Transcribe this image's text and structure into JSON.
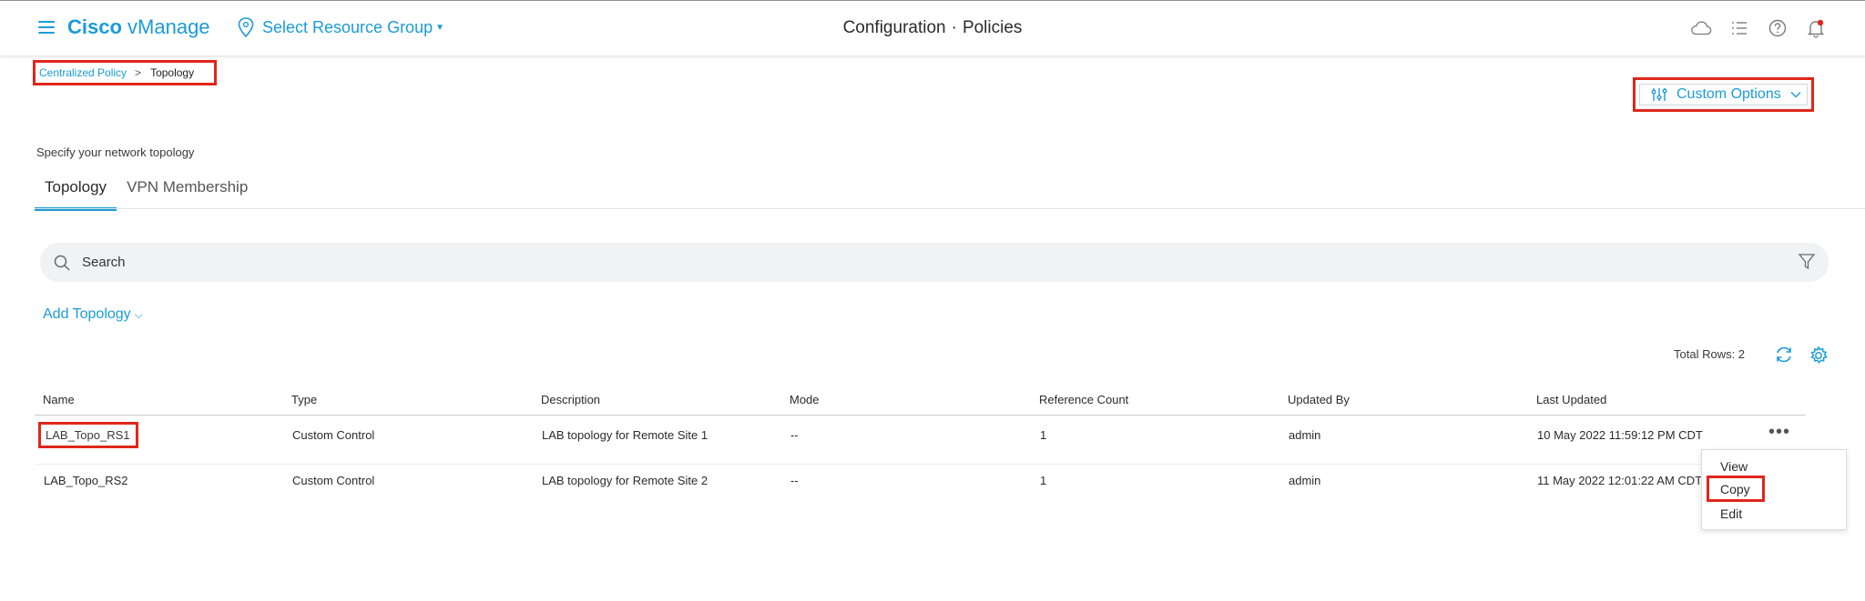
{
  "header": {
    "brand_bold": "Cisco",
    "brand_rest": " vManage",
    "resource_group": "Select Resource Group",
    "title_section": "Configuration",
    "title_dot": "·",
    "title_page": "Policies",
    "icons": [
      "cloud-icon",
      "list-icon",
      "help-icon",
      "bell-icon"
    ],
    "accent_color": "#1b9bd7",
    "notification_color": "#e0261b"
  },
  "breadcrumb": {
    "parent": "Centralized Policy",
    "separator": ">",
    "current": "Topology"
  },
  "custom_options": {
    "label": "Custom Options"
  },
  "page": {
    "subtitle": "Specify your network topology"
  },
  "tabs": [
    {
      "label": "Topology",
      "active": true
    },
    {
      "label": "VPN Membership",
      "active": false
    }
  ],
  "search": {
    "placeholder": "Search"
  },
  "add_topology": {
    "label": "Add Topology"
  },
  "table": {
    "total_rows": "Total Rows: 2",
    "columns": [
      "Name",
      "Type",
      "Description",
      "Mode",
      "Reference Count",
      "Updated By",
      "Last Updated"
    ],
    "rows": [
      {
        "name": "LAB_Topo_RS1",
        "type": "Custom Control",
        "description": "LAB topology for Remote Site 1",
        "mode": "--",
        "reference_count": "1",
        "updated_by": "admin",
        "last_updated": "10 May 2022 11:59:12 PM CDT"
      },
      {
        "name": "LAB_Topo_RS2",
        "type": "Custom Control",
        "description": "LAB topology for Remote Site 2",
        "mode": "--",
        "reference_count": "1",
        "updated_by": "admin",
        "last_updated": "11 May 2022 12:01:22 AM CDT"
      }
    ]
  },
  "row_menu": {
    "items": [
      "View",
      "Copy",
      "Edit"
    ]
  },
  "highlight_color": "#e0261b"
}
